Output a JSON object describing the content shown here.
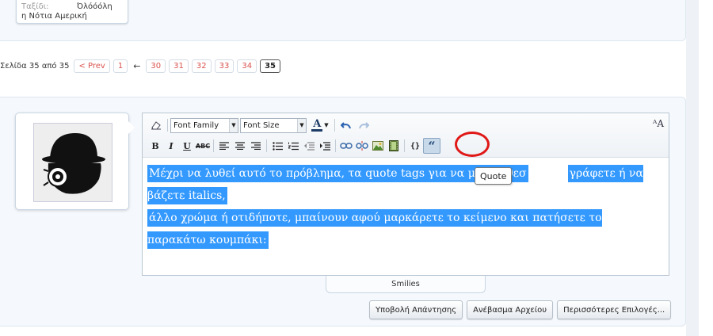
{
  "prev_post": {
    "label": "Ταξίδι:",
    "value": "Όλόόόλη",
    "value2": "η Νότια Αμερική"
  },
  "pagination": {
    "label": "Σελίδα 35 από 35",
    "prev": "< Prev",
    "first": "1",
    "arrow": "←",
    "pages": [
      "30",
      "31",
      "32",
      "33",
      "34"
    ],
    "current": "35"
  },
  "toolbar": {
    "font_family": "Font Family",
    "font_size": "Font Size",
    "bold": "B",
    "italic": "I",
    "underline": "U",
    "strike": "ABC",
    "color_letter": "A",
    "font_toggle": "ᴬA",
    "quote_glyph": "“"
  },
  "tooltip": "Quote",
  "editor": {
    "line1": "Μέχρι να λυθεί αυτό το πρόβλημα, τα quote tags για να μην κάθεσ",
    "line1b": "γράφετε ή να βάζετε italics,",
    "line2": "άλλο χρώμα ή οτιδήποτε, μπαίνουν αφού μαρκάρετε το κείμενο και πατήσετε το παρακάτω κουμπάκι:"
  },
  "smilies_label": "Smilies",
  "actions": {
    "submit": "Υποβολή Απάντησης",
    "upload": "Ανέβασμα Αρχείου",
    "more": "Περισσότερες Επιλογές..."
  },
  "colors": {
    "selection": "#3399ff",
    "link_red": "#d9534f",
    "highlight_ring": "#e01818",
    "panel_bg": "#f5f9fd"
  }
}
